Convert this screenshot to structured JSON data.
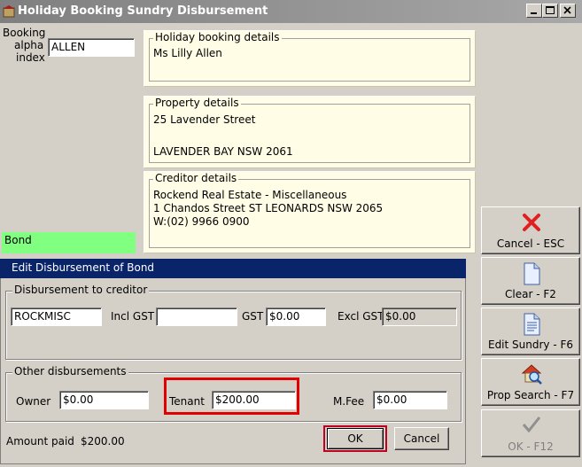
{
  "window": {
    "title": "Holiday Booking Sundry Disbursement",
    "icon": "app-icon"
  },
  "booking": {
    "label_line1": "Booking",
    "label_line2": "alpha",
    "label_line3": "index",
    "value": "ALLEN"
  },
  "holiday_panel": {
    "legend": "Holiday booking details",
    "line1": "Ms Lilly Allen"
  },
  "property_panel": {
    "legend": "Property details",
    "line1": "25 Lavender Street",
    "line2": "LAVENDER BAY  NSW  2061"
  },
  "creditor_panel": {
    "legend": "Creditor details",
    "line1": "Rockend Real Estate - Miscellaneous",
    "line2": "1 Chandos Street ST LEONARDS NSW 2065",
    "line3": "W:(02) 9966 0900"
  },
  "bond_label": "Bond",
  "edit_header": "Edit Disbursement of Bond",
  "creditor_group": {
    "legend": "Disbursement to creditor",
    "code_value": "ROCKMISC",
    "incl_gst_label": "Incl GST",
    "incl_gst_value": "",
    "gst_label": "GST",
    "gst_value": "$0.00",
    "excl_gst_label": "Excl GST",
    "excl_gst_value": "$0.00"
  },
  "other_group": {
    "legend": "Other disbursements",
    "owner_label": "Owner",
    "owner_value": "$0.00",
    "tenant_label": "Tenant",
    "tenant_value": "$200.00",
    "mfee_label": "M.Fee",
    "mfee_value": "$0.00"
  },
  "amount_paid": {
    "label": "Amount paid",
    "value": "$200.00"
  },
  "buttons": {
    "ok": "OK",
    "cancel": "Cancel"
  },
  "side_buttons": [
    {
      "label": "Cancel - ESC",
      "icon": "cancel-x-icon"
    },
    {
      "label": "Clear - F2",
      "icon": "blank-document-icon"
    },
    {
      "label": "Edit Sundry - F6",
      "icon": "edit-document-icon"
    },
    {
      "label": "Prop Search - F7",
      "icon": "house-search-icon"
    },
    {
      "label": "OK - F12",
      "icon": "checkmark-icon"
    }
  ],
  "colors": {
    "title_bar": "#8f8f8f",
    "panel_bg": "#fffde6",
    "bond_bg": "#80ff80",
    "edit_header_bg": "#0a246a",
    "highlight_red": "#e00000"
  }
}
